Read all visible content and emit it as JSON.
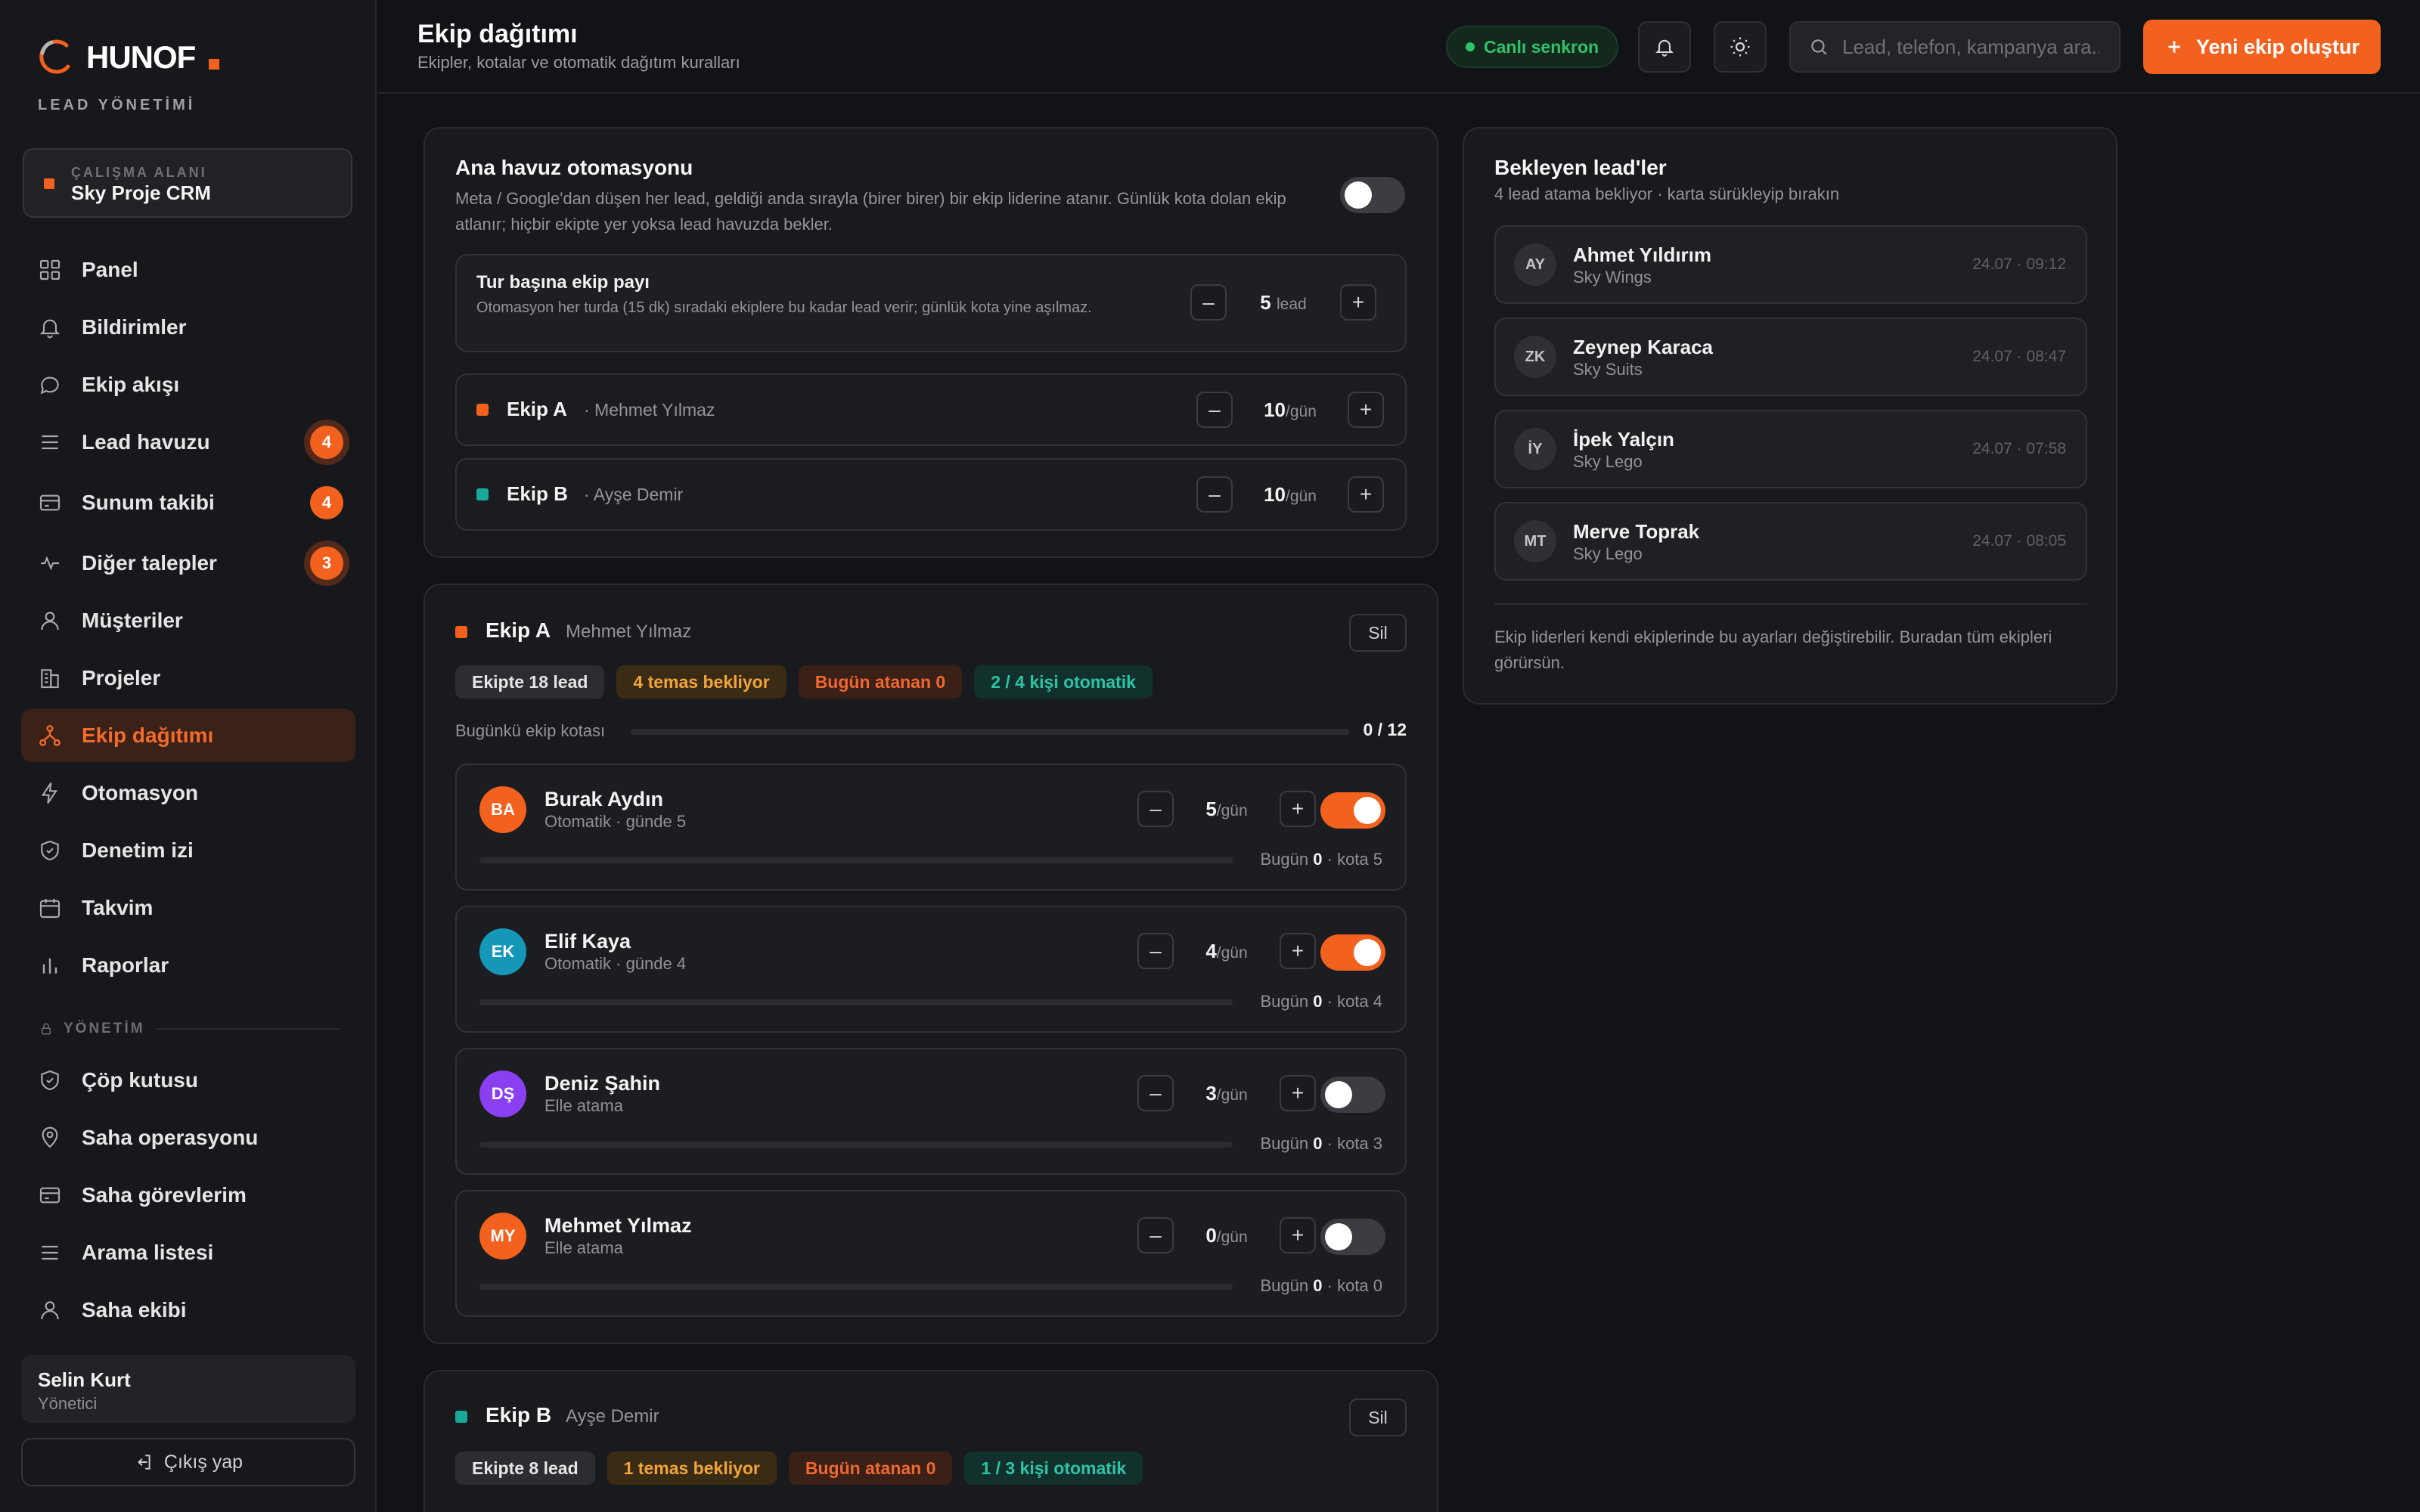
{
  "brand": {
    "name": "HUNOF",
    "subtitle": "LEAD YÖNETİMİ",
    "accent": "#f2611d"
  },
  "workspace": {
    "label": "ÇALIŞMA ALANI",
    "name": "Sky Proje CRM"
  },
  "nav": [
    {
      "label": "Panel",
      "icon": "grid-icon"
    },
    {
      "label": "Bildirimler",
      "icon": "bell-icon"
    },
    {
      "label": "Ekip akışı",
      "icon": "chat-icon"
    },
    {
      "label": "Lead havuzu",
      "icon": "list-icon",
      "badge": "4"
    },
    {
      "label": "Sunum takibi",
      "icon": "card-icon",
      "badge": "4"
    },
    {
      "label": "Diğer talepler",
      "icon": "activity-icon",
      "badge": "3"
    },
    {
      "label": "Müşteriler",
      "icon": "user-icon"
    },
    {
      "label": "Projeler",
      "icon": "building-icon"
    },
    {
      "label": "Ekip dağıtımı",
      "icon": "share-icon",
      "active": true
    },
    {
      "label": "Otomasyon",
      "icon": "bolt-icon"
    },
    {
      "label": "Denetim izi",
      "icon": "shield-icon"
    },
    {
      "label": "Takvim",
      "icon": "calendar-icon"
    },
    {
      "label": "Raporlar",
      "icon": "bar-chart-icon"
    }
  ],
  "admin_section": "YÖNETİM",
  "admin_nav": [
    {
      "label": "Çöp kutusu",
      "icon": "shield-icon"
    },
    {
      "label": "Saha operasyonu",
      "icon": "pin-icon"
    },
    {
      "label": "Saha görevlerim",
      "icon": "card-icon"
    },
    {
      "label": "Arama listesi",
      "icon": "list-icon"
    },
    {
      "label": "Saha ekibi",
      "icon": "user-icon"
    }
  ],
  "user": {
    "name": "Selin Kurt",
    "role": "Yönetici"
  },
  "logout_label": "Çıkış yap",
  "header": {
    "title": "Ekip dağıtımı",
    "subtitle": "Ekipler, kotalar ve otomatik dağıtım kuralları",
    "live_label": "Canlı senkron",
    "search_placeholder": "Lead, telefon, kampanya ara...",
    "new_team_label": "Yeni ekip oluştur"
  },
  "automation": {
    "title": "Ana havuz otomasyonu",
    "description": "Meta / Google'dan düşen her lead, geldiği anda sırayla (birer birer) bir ekip liderine atanır. Günlük kota dolan ekip atlanır; hiçbir ekipte yer yoksa lead havuzda bekler.",
    "enabled": false,
    "share": {
      "title": "Tur başına ekip payı",
      "description": "Otomasyon her turda (15 dk) sıradaki ekiplere bu kadar lead verir; günlük kota yine aşılmaz.",
      "value": "5",
      "unit": "lead"
    },
    "teams": [
      {
        "name": "Ekip A",
        "leader": "· Mehmet Yılmaz",
        "color": "#f2611d",
        "value": "10",
        "unit": "/gün"
      },
      {
        "name": "Ekip B",
        "leader": "· Ayşe Demir",
        "color": "#17a99a",
        "value": "10",
        "unit": "/gün"
      }
    ]
  },
  "team_a": {
    "name": "Ekip A",
    "leader": "Mehmet Yılmaz",
    "color": "#f2611d",
    "delete_label": "Sil",
    "chips": [
      "Ekipte 18 lead",
      "4 temas bekliyor",
      "Bugün atanan 0",
      "2 / 4 kişi otomatik"
    ],
    "quota_label": "Bugünkü ekip kotası",
    "quota_value": "0 / 12",
    "quota_fraction": 0,
    "members": [
      {
        "initials": "BA",
        "name": "Burak Aydın",
        "mode": "Otomatik · günde 5",
        "value": "5",
        "unit": "/gün",
        "auto": true,
        "color": "#f2611d",
        "today_label": "Bugün",
        "today": "0",
        "quota": "· kota 5"
      },
      {
        "initials": "EK",
        "name": "Elif Kaya",
        "mode": "Otomatik · günde 4",
        "value": "4",
        "unit": "/gün",
        "auto": true,
        "color": "#1597b8",
        "today_label": "Bugün",
        "today": "0",
        "quota": "· kota 4"
      },
      {
        "initials": "DŞ",
        "name": "Deniz Şahin",
        "mode": "Elle atama",
        "value": "3",
        "unit": "/gün",
        "auto": false,
        "color": "#8a3ff0",
        "today_label": "Bugün",
        "today": "0",
        "quota": "· kota 3"
      },
      {
        "initials": "MY",
        "name": "Mehmet Yılmaz",
        "mode": "Elle atama",
        "value": "0",
        "unit": "/gün",
        "auto": false,
        "color": "#f2611d",
        "today_label": "Bugün",
        "today": "0",
        "quota": "· kota 0"
      }
    ]
  },
  "team_b": {
    "name": "Ekip B",
    "leader": "Ayşe Demir",
    "color": "#17a99a",
    "delete_label": "Sil",
    "chips": [
      "Ekipte 8 lead",
      "1 temas bekliyor",
      "Bugün atanan 0",
      "1 / 3 kişi otomatik"
    ]
  },
  "pending": {
    "title": "Bekleyen lead'ler",
    "subtitle": "4 lead atama bekliyor · karta sürükleyip bırakın",
    "leads": [
      {
        "initials": "AY",
        "name": "Ahmet Yıldırım",
        "campaign": "Sky Wings",
        "time": "24.07 · 09:12"
      },
      {
        "initials": "ZK",
        "name": "Zeynep Karaca",
        "campaign": "Sky Suits",
        "time": "24.07 · 08:47"
      },
      {
        "initials": "İY",
        "name": "İpek Yalçın",
        "campaign": "Sky Lego",
        "time": "24.07 · 07:58"
      },
      {
        "initials": "MT",
        "name": "Merve Toprak",
        "campaign": "Sky Lego",
        "time": "24.07 · 08:05"
      }
    ],
    "note": "Ekip liderleri kendi ekiplerinde bu ayarları değiştirebilir. Buradan tüm ekipleri görürsün."
  }
}
